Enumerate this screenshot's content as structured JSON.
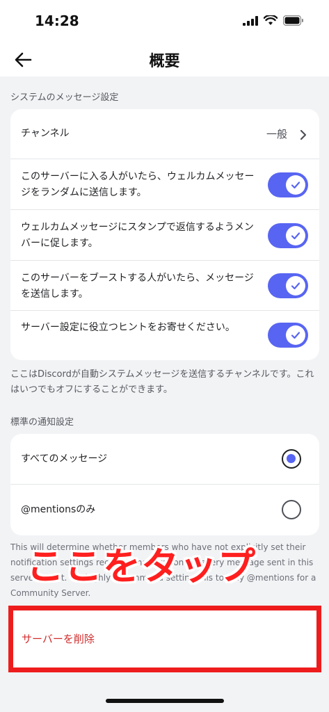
{
  "status": {
    "time": "14:28"
  },
  "nav": {
    "title": "概要"
  },
  "system_messages": {
    "header": "システムのメッセージ設定",
    "channel_label": "チャンネル",
    "channel_value": "一般",
    "toggles": [
      {
        "label": "このサーバーに入る人がいたら、ウェルカムメッセージをランダムに送信します。",
        "on": true
      },
      {
        "label": "ウェルカムメッセージにスタンプで返信するようメンバーに促します。",
        "on": true
      },
      {
        "label": "このサーバーをブーストする人がいたら、メッセージを送信します。",
        "on": true
      },
      {
        "label": "サーバー設定に役立つヒントをお寄せください。",
        "on": true
      }
    ],
    "help": "ここはDiscordが自動システムメッセージを送信するチャンネルです。これはいつでもオフにすることができます。"
  },
  "notifications": {
    "header": "標準の通知設定",
    "options": [
      {
        "label": "すべてのメッセージ",
        "selected": true
      },
      {
        "label": "@mentionsのみ",
        "selected": false
      }
    ],
    "help": "This will determine whether members who have not explicitly set their notification settings receive a notification for every message sent in this server or not. We highly recommend setting this to only @mentions for a Community Server."
  },
  "annotation": "ここをタップ",
  "delete_button": "サーバーを削除",
  "colors": {
    "accent": "#5865f2",
    "danger": "#d02c2c",
    "highlight": "#ee1d1d"
  }
}
